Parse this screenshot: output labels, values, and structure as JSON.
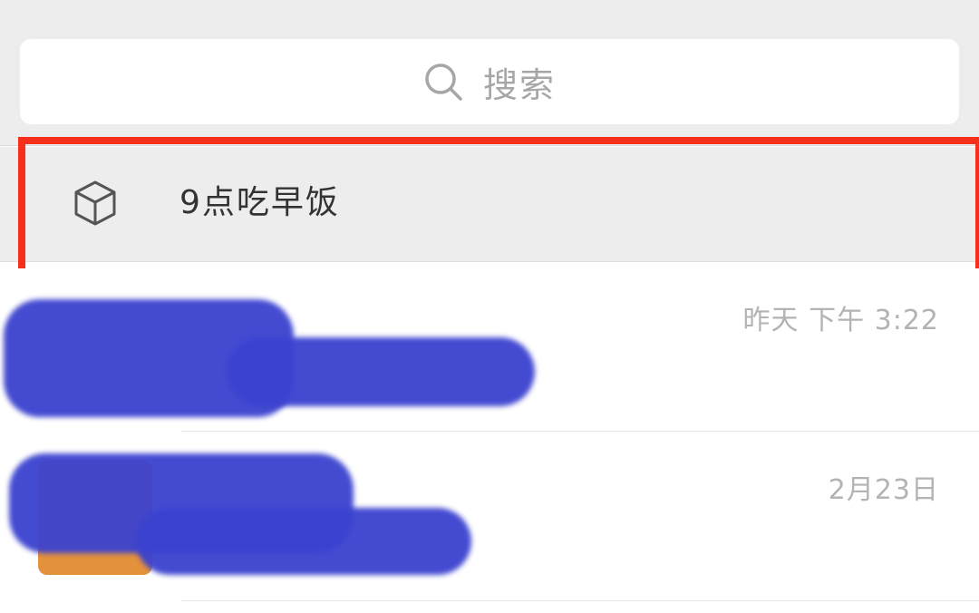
{
  "search": {
    "placeholder": "搜索",
    "icon": "search-icon"
  },
  "pinned": {
    "label": "9点吃早饭",
    "icon": "cube-icon"
  },
  "chats": [
    {
      "time": "昨天 下午 3:22",
      "redacted": true
    },
    {
      "time": "2月23日",
      "redacted": true
    }
  ],
  "colors": {
    "header_bg": "#ededed",
    "highlight": "#f52f19",
    "redaction": "#3b42cf",
    "avatar": "#e4913c"
  }
}
